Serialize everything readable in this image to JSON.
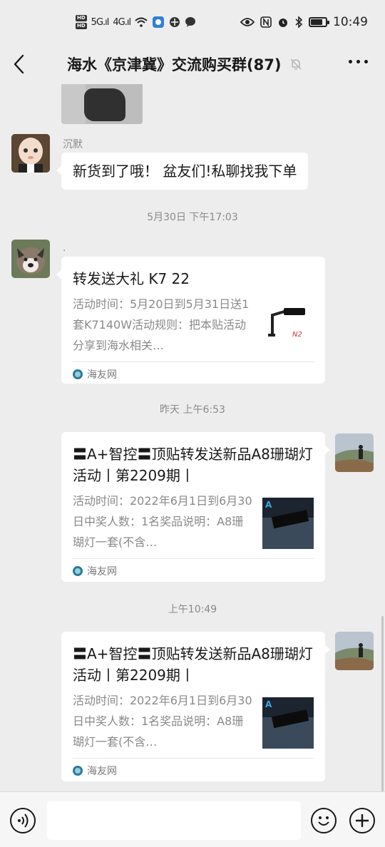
{
  "status_bar": {
    "hd1": "HD",
    "hd2": "HD",
    "sig1": "5G.ıl",
    "sig2": "4G.ıl",
    "time": "10:49",
    "battery_level": 0.8
  },
  "nav": {
    "title": "海水《京津冀》交流购买群(87)"
  },
  "messages": {
    "m1": {
      "sender": "沉默",
      "text": "新货到了哦！ 盆友们!私聊找我下单"
    },
    "ts1": "5月30日 下午17:03",
    "m2": {
      "sender": ".",
      "title": "转发送大礼 K7 22",
      "desc": "活动时间：5月20日到5月31日送1套K7140W活动规则：把本贴活动分享到海水相关…",
      "source": "海友网",
      "thumb_label": "N2"
    },
    "ts2": "昨天 上午6:53",
    "m3": {
      "title": "〓A+智控〓顶贴转发送新品A8珊瑚灯活动丨第2209期丨",
      "desc": "活动时间：2022年6月1日到6月30日中奖人数：1名奖品说明：A8珊瑚灯一套(不含…",
      "source": "海友网",
      "thumb_label": "A"
    },
    "ts3": "上午10:49",
    "m4": {
      "title": "〓A+智控〓顶贴转发送新品A8珊瑚灯活动丨第2209期丨",
      "desc": "活动时间：2022年6月1日到6月30日中奖人数：1名奖品说明：A8珊瑚灯一套(不含…",
      "source": "海友网",
      "thumb_label": "A"
    }
  },
  "input": {
    "value": "",
    "placeholder": ""
  },
  "icons": {
    "back": "chevron-left-icon",
    "more": "more-dots-icon",
    "mute": "bell-off-icon",
    "voice": "voice-icon",
    "emoji": "emoji-icon",
    "plus": "plus-icon"
  }
}
